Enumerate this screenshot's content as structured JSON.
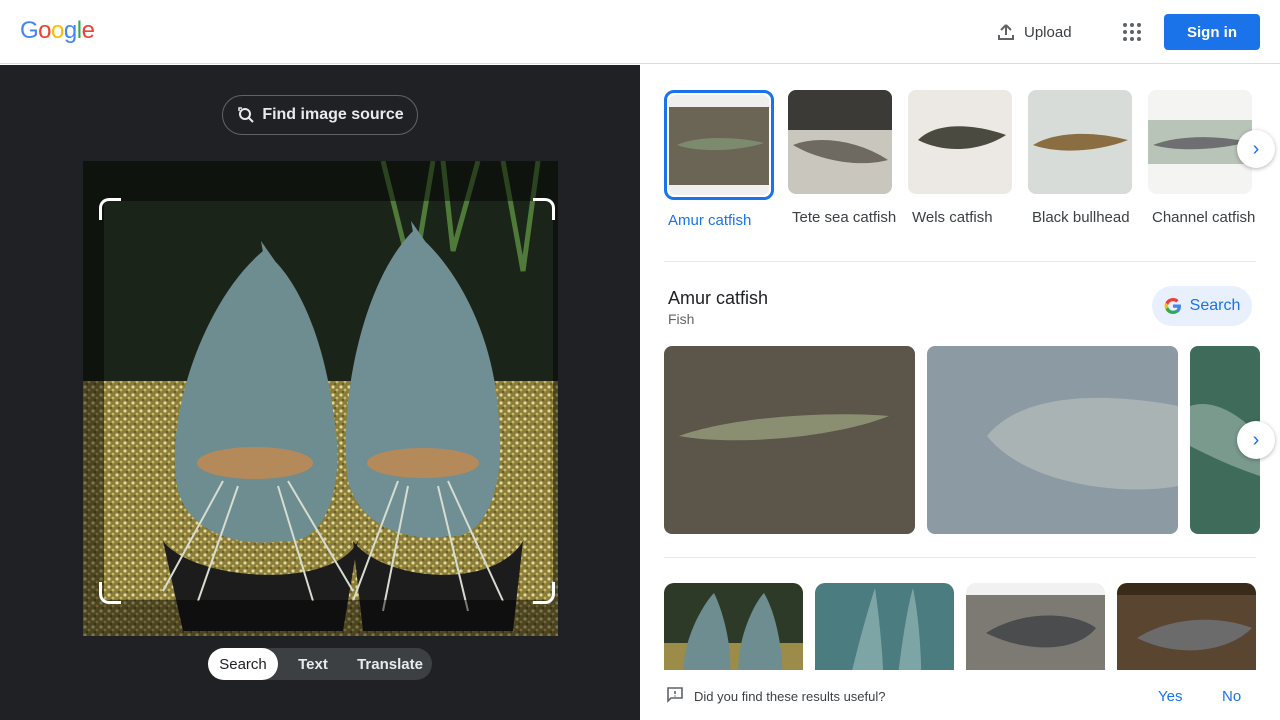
{
  "header": {
    "logo_letters": [
      "G",
      "o",
      "o",
      "g",
      "l",
      "e"
    ],
    "upload_label": "Upload",
    "apps_icon": "apps-grid-icon",
    "signin_label": "Sign in"
  },
  "colors": {
    "accent": "#1a73e8",
    "logo": [
      "#4285f4",
      "#ea4335",
      "#fbbc05",
      "#4285f4",
      "#34a853",
      "#ea4335"
    ],
    "dark_panel": "#202124"
  },
  "lens": {
    "find_source_label": "Find image source",
    "modes": [
      "Search",
      "Text",
      "Translate"
    ],
    "active_mode": "Search"
  },
  "entities": [
    {
      "label": "Amur catfish",
      "selected": true
    },
    {
      "label": "Tete sea catfish",
      "selected": false
    },
    {
      "label": "Wels catfish",
      "selected": false
    },
    {
      "label": "Black bullhead",
      "selected": false
    },
    {
      "label": "Channel catfish",
      "selected": false
    }
  ],
  "knowledge": {
    "title": "Amur catfish",
    "subtitle": "Fish",
    "search_label": "Search"
  },
  "feedback": {
    "question": "Did you find these results useful?",
    "yes": "Yes",
    "no": "No"
  }
}
